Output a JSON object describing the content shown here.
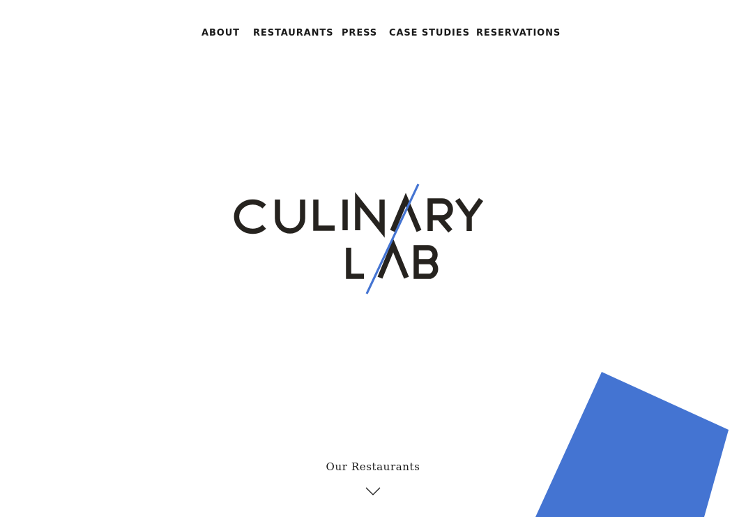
{
  "nav": {
    "items": [
      {
        "label": "ABOUT"
      },
      {
        "label": "RESTAURANTS"
      },
      {
        "label": "PRESS"
      },
      {
        "label": "CASE STUDIES"
      },
      {
        "label": "RESERVATIONS"
      }
    ]
  },
  "logo": {
    "line1": "CULINARY",
    "line2": "LAB",
    "text_color": "#26231f",
    "slash_color": "#4474d2"
  },
  "cta": {
    "label": "Our Restaurants",
    "icon": "chevron-down-icon"
  },
  "colors": {
    "accent": "#4474d2",
    "text": "#1a1a1a",
    "background": "#ffffff"
  }
}
